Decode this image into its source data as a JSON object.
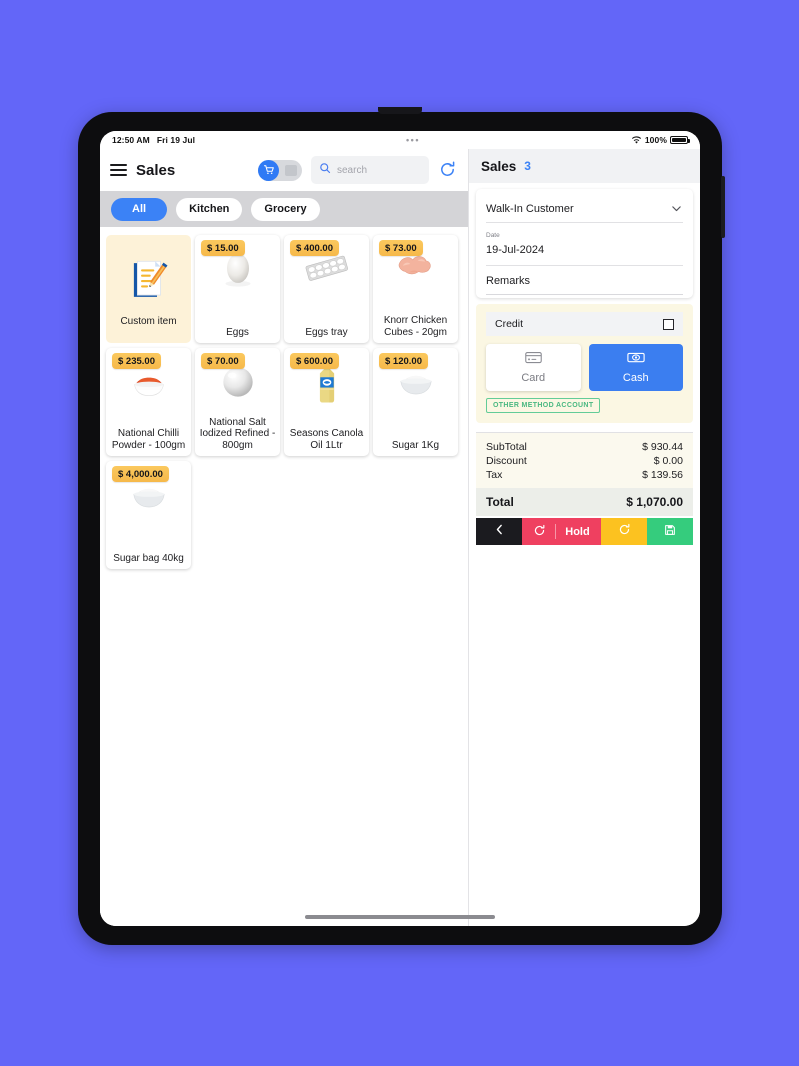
{
  "status_bar": {
    "time": "12:50 AM",
    "date": "Fri 19 Jul",
    "dots": "•••",
    "battery_pct": "100%"
  },
  "topbar": {
    "title": "Sales",
    "menu_icon": "hamburger-icon",
    "toggle_icon": "cart-icon",
    "search_placeholder": "search",
    "search_value": "",
    "refresh_icon": "refresh-icon"
  },
  "categories": [
    {
      "label": "All",
      "active": true
    },
    {
      "label": "Kitchen",
      "active": false
    },
    {
      "label": "Grocery",
      "active": false
    }
  ],
  "products": [
    {
      "name": "Custom item",
      "price": "",
      "custom": true,
      "thumb": "document-pencil-icon"
    },
    {
      "name": "Eggs",
      "price": "$ 15.00",
      "thumb": "egg-image"
    },
    {
      "name": "Eggs tray",
      "price": "$ 400.00",
      "thumb": "egg-tray-image"
    },
    {
      "name": "Knorr Chicken Cubes - 20gm",
      "price": "$ 73.00",
      "thumb": "chicken-image"
    },
    {
      "name": "National Chilli Powder - 100gm",
      "price": "$ 235.00",
      "thumb": "chilli-bowl-image"
    },
    {
      "name": "National Salt Iodized Refined - 800gm",
      "price": "$ 70.00",
      "thumb": "salt-image"
    },
    {
      "name": "Seasons Canola Oil 1Ltr",
      "price": "$ 600.00",
      "thumb": "oil-bottle-image"
    },
    {
      "name": "Sugar 1Kg",
      "price": "$ 120.00",
      "thumb": "sugar-bowl-image"
    },
    {
      "name": "Sugar bag 40kg",
      "price": "$ 4,000.00",
      "thumb": "sugar-bowl-image"
    }
  ],
  "sales_panel": {
    "title": "Sales",
    "count": "3",
    "customer": "Walk-In Customer",
    "date_label": "Date",
    "date_value": "19-Jul-2024",
    "remarks_label": "Remarks",
    "credit_label": "Credit",
    "credit_checked": false,
    "pay_card_label": "Card",
    "pay_cash_label": "Cash",
    "other_method_label": "OTHER METHOD ACCOUNT",
    "totals": [
      {
        "label": "SubTotal",
        "value": "$ 930.44"
      },
      {
        "label": "Discount",
        "value": "$ 0.00"
      },
      {
        "label": "Tax",
        "value": "$ 139.56"
      }
    ],
    "total_label": "Total",
    "total_value": "$ 1,070.00",
    "actions": {
      "back_icon": "chevron-left-icon",
      "hold_label": "Hold",
      "hold_icon": "reset-icon",
      "refresh_icon": "refresh-cw-icon",
      "save_icon": "save-disk-icon"
    }
  },
  "colors": {
    "page_background": "#6366F8",
    "accent_blue": "#3b82f6",
    "price_tag": "#f6b94a",
    "custom_card": "#fdf2d8",
    "pay_block": "#fbf7e3",
    "hold_red": "#ef4060",
    "refresh_yellow": "#fcc220",
    "save_green": "#35cc7d",
    "other_method_green": "#49b881"
  }
}
